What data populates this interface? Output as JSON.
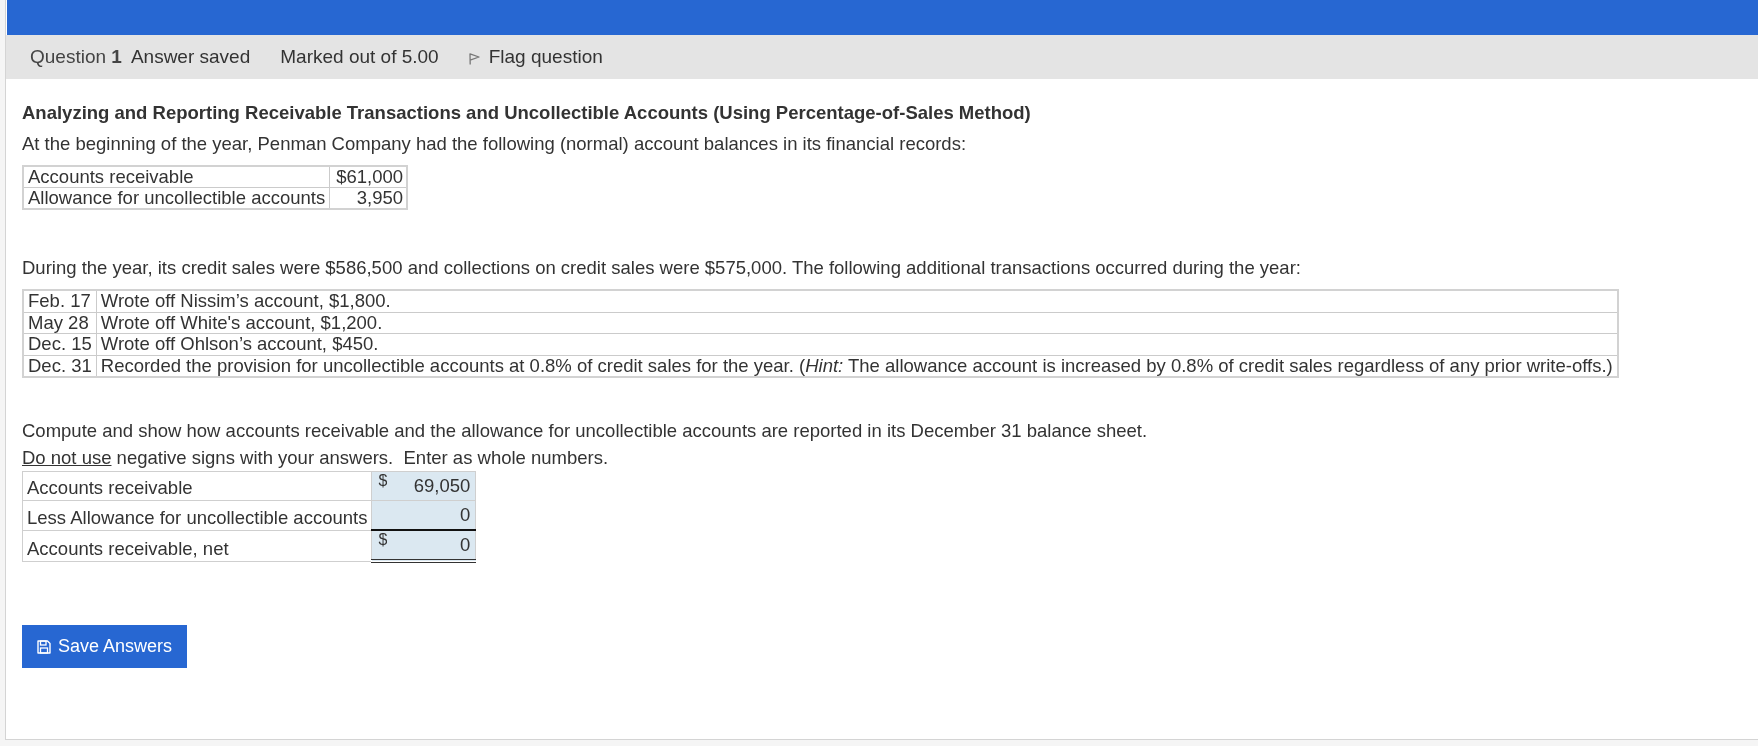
{
  "header": {
    "question": "Question **1**",
    "status": "Answer saved",
    "marks": "Marked out of 5.00",
    "flag": "Flag question"
  },
  "question": {
    "title": "Analyzing and Reporting Receivable Transactions and Uncollectible Accounts (Using Percentage-of-Sales Method)",
    "intro": "At the beginning of the year, Penman Company had the following (normal) account balances in its financial records:",
    "balances": [
      {
        "account": "Accounts receivable",
        "amount": "$61,000"
      },
      {
        "account": "Allowance for uncollectible accounts",
        "amount": "3,950"
      }
    ],
    "transactions_intro": "During the year, its credit sales were $586,500 and collections on credit sales were $575,000. The following additional transactions occurred during the year:",
    "transactions": [
      {
        "date": "Feb. 17",
        "description": "Wrote off Nissim’s account, $1,800."
      },
      {
        "date": "May 28",
        "description": "Wrote off White's account, $1,200."
      },
      {
        "date": "Dec. 15",
        "description": "Wrote off Ohlson’s account, $450."
      },
      {
        "date": "Dec. 31",
        "description": "Recorded the provision for uncollectible accounts at 0.8% of credit sales for the year. (*Hint:* The allowance account is increased by 0.8% of credit sales regardless of any prior write-offs.)"
      }
    ],
    "task": "Compute and show how accounts receivable and the allowance for uncollectible accounts are reported in its December 31 balance sheet.",
    "instruction": {
      "underlined": "Do not use",
      "text": "negative signs with your answers.  Enter as whole numbers."
    }
  },
  "answers": [
    {
      "kind": "entry",
      "label": "Accounts receivable",
      "currency": "$",
      "value": "69,050"
    },
    {
      "kind": "subtotal",
      "label": "Less Allowance for uncollectible accounts",
      "value": "0"
    },
    {
      "kind": "total",
      "label": "Accounts receivable, net",
      "currency": "$",
      "value": "0"
    }
  ],
  "save_button": {
    "label": "Save Answers"
  }
}
